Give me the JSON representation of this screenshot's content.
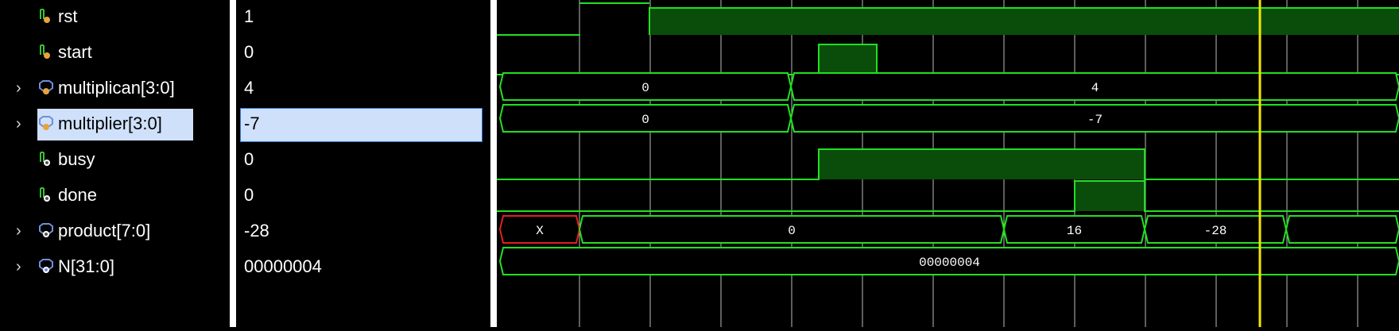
{
  "signals": [
    {
      "name": "rst",
      "value": "1",
      "expandable": false,
      "icon": "wire-in-icon"
    },
    {
      "name": "start",
      "value": "0",
      "expandable": false,
      "icon": "wire-in-icon"
    },
    {
      "name": "multiplican[3:0]",
      "value": "4",
      "expandable": true,
      "icon": "bus-in-icon"
    },
    {
      "name": "multiplier[3:0]",
      "value": "-7",
      "expandable": true,
      "icon": "bus-in-icon",
      "selected": true
    },
    {
      "name": "busy",
      "value": "0",
      "expandable": false,
      "icon": "wire-out-icon"
    },
    {
      "name": "done",
      "value": "0",
      "expandable": false,
      "icon": "wire-out-icon"
    },
    {
      "name": "product[7:0]",
      "value": "-28",
      "expandable": true,
      "icon": "bus-out-icon"
    },
    {
      "name": "N[31:0]",
      "value": "00000004",
      "expandable": true,
      "icon": "bus-param-icon"
    }
  ],
  "waveform": {
    "bus_labels": {
      "multiplican": [
        "0",
        "4"
      ],
      "multiplier": [
        "0",
        "-7"
      ],
      "product": [
        "X",
        "0",
        "16",
        "-28"
      ],
      "N": [
        "00000004"
      ]
    },
    "colors": {
      "wave": "#22e022",
      "high_fill": "#0a4d0a",
      "grid": "#bdbdbd",
      "cursor": "#f2e600",
      "x_state": "#e02020"
    }
  }
}
